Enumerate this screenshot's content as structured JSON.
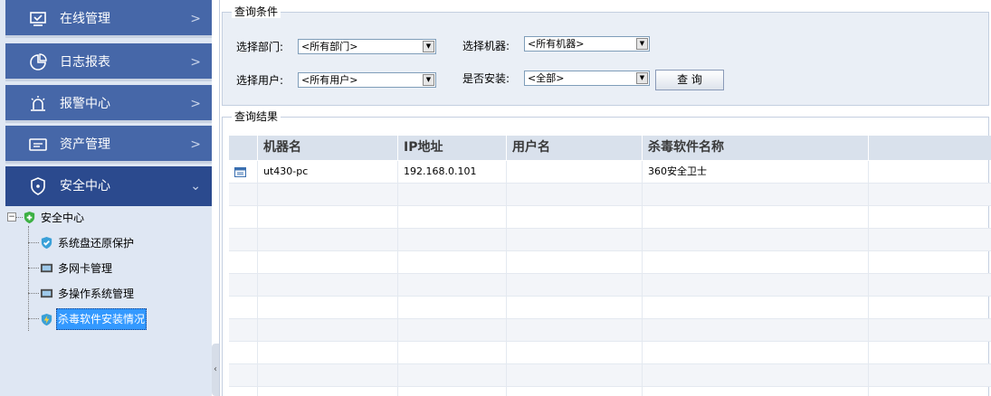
{
  "sidebar": {
    "nav": [
      {
        "label": "在线管理",
        "icon": "monitor-check-icon"
      },
      {
        "label": "日志报表",
        "icon": "pie-chart-icon"
      },
      {
        "label": "报警中心",
        "icon": "alarm-icon"
      },
      {
        "label": "资产管理",
        "icon": "asset-card-icon"
      },
      {
        "label": "安全中心",
        "icon": "shield-icon",
        "active": true
      }
    ],
    "tree": {
      "root": "安全中心",
      "children": [
        "系统盘还原保护",
        "多网卡管理",
        "多操作系统管理",
        "杀毒软件安装情况"
      ],
      "selected": "杀毒软件安装情况"
    }
  },
  "query": {
    "legend": "查询条件",
    "dept_label": "选择部门:",
    "dept_value": "<所有部门>",
    "machine_label": "选择机器:",
    "machine_value": "<所有机器>",
    "user_label": "选择用户:",
    "user_value": "<所有用户>",
    "installed_label": "是否安装:",
    "installed_value": "<全部>",
    "search_button": "查 询"
  },
  "results": {
    "legend": "查询结果",
    "columns": [
      "机器名",
      "IP地址",
      "用户名",
      "杀毒软件名称"
    ],
    "rows": [
      {
        "machine": "ut430-pc",
        "ip": "192.168.0.101",
        "user": "",
        "av": "360安全卫士"
      }
    ]
  },
  "colors": {
    "nav_bg": "#4667a8",
    "nav_active": "#2b4a8e",
    "sidebar_bg": "#dfe7f3",
    "selection": "#3399ff"
  }
}
